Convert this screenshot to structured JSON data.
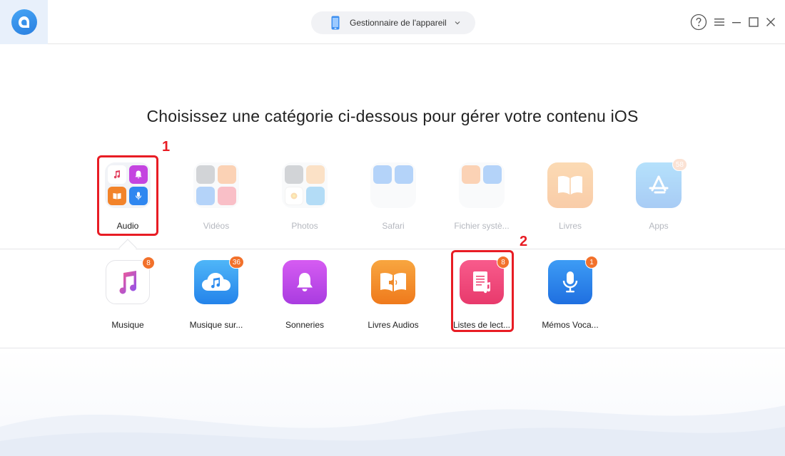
{
  "header": {
    "device_manager_label": "Gestionnaire de l'appareil",
    "help_label": "?"
  },
  "heading": "Choisissez une catégorie ci-dessous pour gérer votre contenu iOS",
  "steps": {
    "step1": "1",
    "step2": "2"
  },
  "categories": [
    {
      "label": "Audio"
    },
    {
      "label": "Vidéos"
    },
    {
      "label": "Photos"
    },
    {
      "label": "Safari"
    },
    {
      "label": "Fichier systè..."
    },
    {
      "label": "Livres"
    },
    {
      "label": "Apps",
      "badge": "58"
    }
  ],
  "subcategories": [
    {
      "label": "Musique",
      "badge": "8"
    },
    {
      "label": "Musique sur...",
      "badge": "36"
    },
    {
      "label": "Sonneries"
    },
    {
      "label": "Livres Audios"
    },
    {
      "label": "Listes de lect...",
      "badge": "8"
    },
    {
      "label": "Mémos Voca...",
      "badge": "1"
    }
  ],
  "colors": {
    "accent_red": "#e81c24",
    "badge_orange": "#f2712b",
    "brand_blue": "#2a7fe0"
  }
}
